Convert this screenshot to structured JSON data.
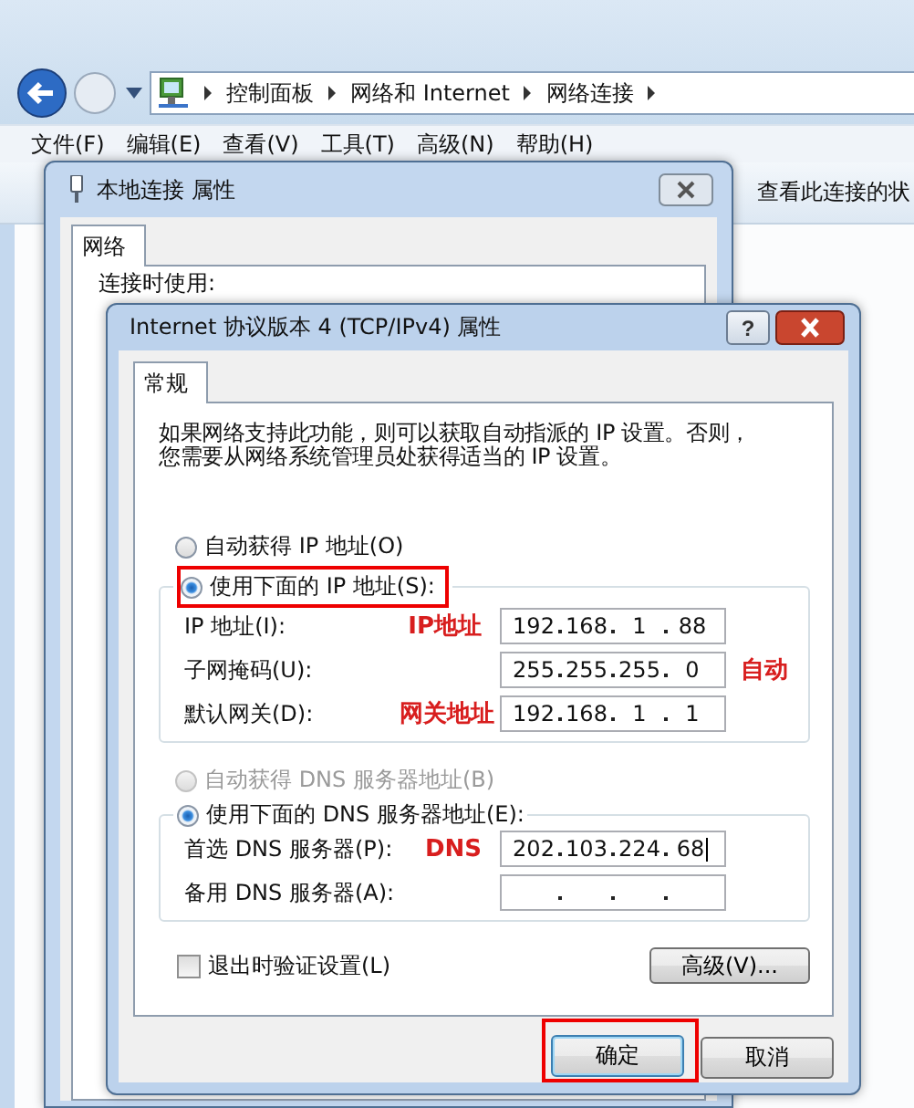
{
  "explorer": {
    "breadcrumb": [
      "控制面板",
      "网络和 Internet",
      "网络连接"
    ],
    "menu": [
      "文件(F)",
      "编辑(E)",
      "查看(V)",
      "工具(T)",
      "高级(N)",
      "帮助(H)"
    ],
    "toolbar_text": "查看此连接的状"
  },
  "properties_window": {
    "title": "本地连接 属性",
    "tabs": [
      {
        "label": "网络",
        "selected": true
      }
    ],
    "connect_label": "连接时使用:"
  },
  "dialog": {
    "title": "Internet 协议版本 4 (TCP/IPv4) 属性",
    "help_button": "?",
    "tabs": [
      {
        "label": "常规",
        "selected": true
      }
    ],
    "description_lines": [
      "如果网络支持此功能，则可以获取自动指派的 IP 设置。否则，",
      "您需要从网络系统管理员处获得适当的 IP 设置。"
    ],
    "ip_auto": {
      "label": "自动获得 IP 地址(O)",
      "selected": false,
      "disabled": false
    },
    "ip_manual": {
      "label": "使用下面的 IP 地址(S):",
      "selected": true,
      "disabled": false,
      "highlighted": true
    },
    "ip_fields": [
      {
        "label": "IP 地址(I):",
        "octets": [
          "192",
          "168",
          "1",
          "88"
        ],
        "annotation": "IP地址"
      },
      {
        "label": "子网掩码(U):",
        "octets": [
          "255",
          "255",
          "255",
          "0"
        ],
        "side_note": "自动"
      },
      {
        "label": "默认网关(D):",
        "octets": [
          "192",
          "168",
          "1",
          "1"
        ],
        "annotation": "网关地址"
      }
    ],
    "dns_auto": {
      "label": "自动获得 DNS 服务器地址(B)",
      "selected": false,
      "disabled": true
    },
    "dns_manual": {
      "label": "使用下面的 DNS 服务器地址(E):",
      "selected": true,
      "disabled": false
    },
    "dns_fields": [
      {
        "label": "首选 DNS 服务器(P):",
        "octets": [
          "202",
          "103",
          "224",
          "68"
        ],
        "focused": true,
        "annotation": "DNS"
      },
      {
        "label": "备用 DNS 服务器(A):"
      }
    ],
    "validate_checkbox": {
      "label": "退出时验证设置(L)",
      "checked": false
    },
    "advanced_button": "高级(V)...",
    "buttons": [
      {
        "label": "确定",
        "default": true,
        "highlighted": true
      },
      {
        "label": "取消",
        "default": false,
        "highlighted": false
      }
    ]
  }
}
